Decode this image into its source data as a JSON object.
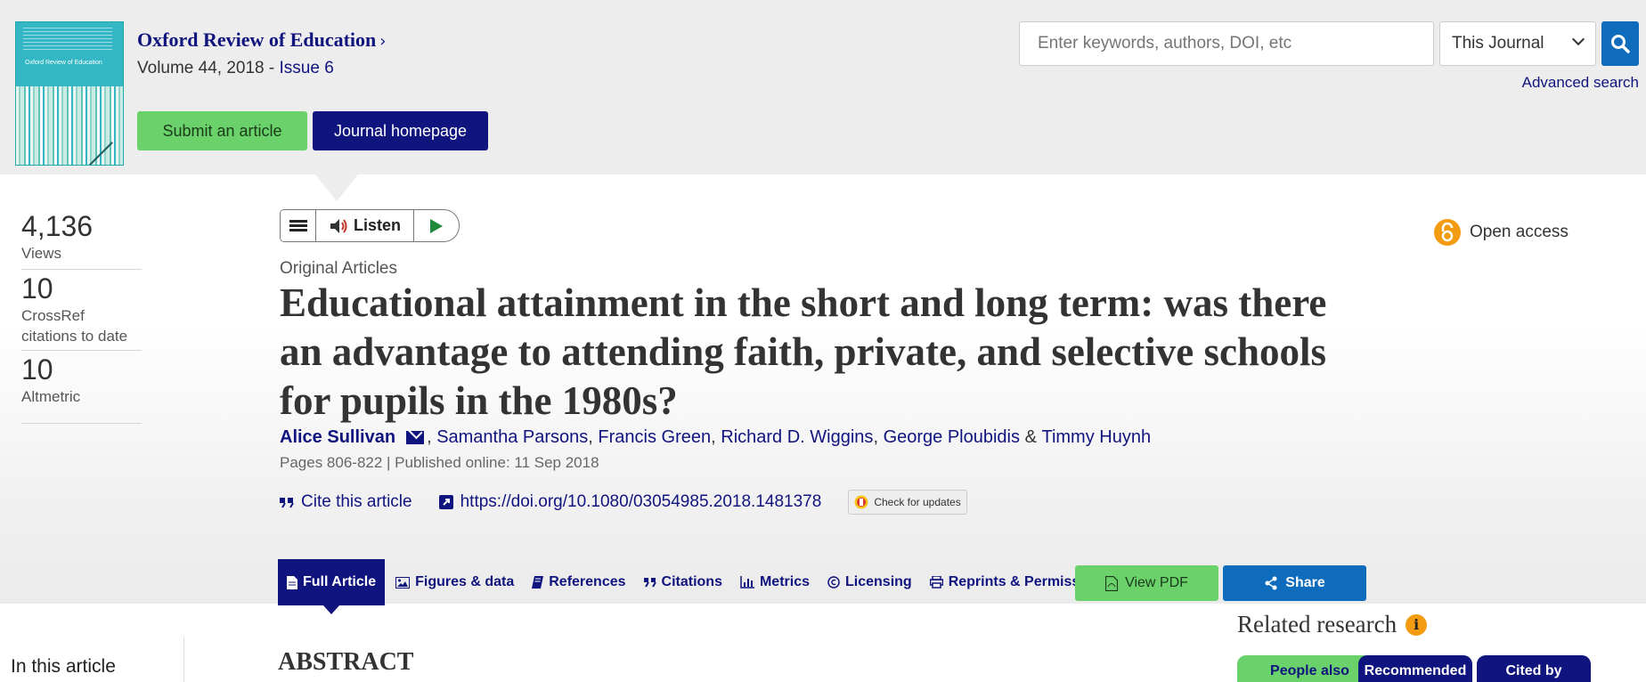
{
  "header": {
    "cover_title": "Oxford Review of Education",
    "journal_title": "Oxford Review of Education",
    "journal_chevron": "›",
    "volume": "Volume 44, 2018 - ",
    "issue": "Issue 6",
    "submit_label": "Submit an article",
    "homepage_label": "Journal homepage"
  },
  "search": {
    "placeholder": "Enter keywords, authors, DOI, etc",
    "scope": "This Journal",
    "advanced": "Advanced search"
  },
  "metrics": [
    {
      "value": "4,136",
      "label": "Views"
    },
    {
      "value": "10",
      "label": "CrossRef citations to date"
    },
    {
      "value": "10",
      "label": "Altmetric"
    }
  ],
  "toolbar": {
    "listen_label": "Listen"
  },
  "open_access": "Open access",
  "article": {
    "category": "Original Articles",
    "title": "Educational attainment in the short and long term: was there an advantage to attending faith, private, and selective schools for pupils in the 1980s?",
    "authors": [
      "Alice Sullivan",
      "Samantha Parsons",
      "Francis Green",
      "Richard D. Wiggins",
      "George Ploubidis",
      "Timmy Huynh"
    ],
    "author_comma": ",",
    "author_amp": "&",
    "pages": "Pages 806-822 | Published online: 11 Sep 2018",
    "cite_label": "Cite this article",
    "doi": "https://doi.org/10.1080/03054985.2018.1481378",
    "check_updates": "Check for updates"
  },
  "tabs": [
    "Full Article",
    "Figures & data",
    "References",
    "Citations",
    "Metrics",
    "Licensing",
    "Reprints & Permissions"
  ],
  "actions": {
    "pdf": "View PDF",
    "share": "Share"
  },
  "below": {
    "in_article": "In this article",
    "abstract": "ABSTRACT",
    "related": "Related research",
    "related_tabs": [
      "People also",
      "Recommended",
      "Cited by"
    ]
  },
  "colors": {
    "navy": "#10147e",
    "green": "#6bd26b",
    "blue": "#0f6cbd",
    "orange": "#f39c12"
  }
}
